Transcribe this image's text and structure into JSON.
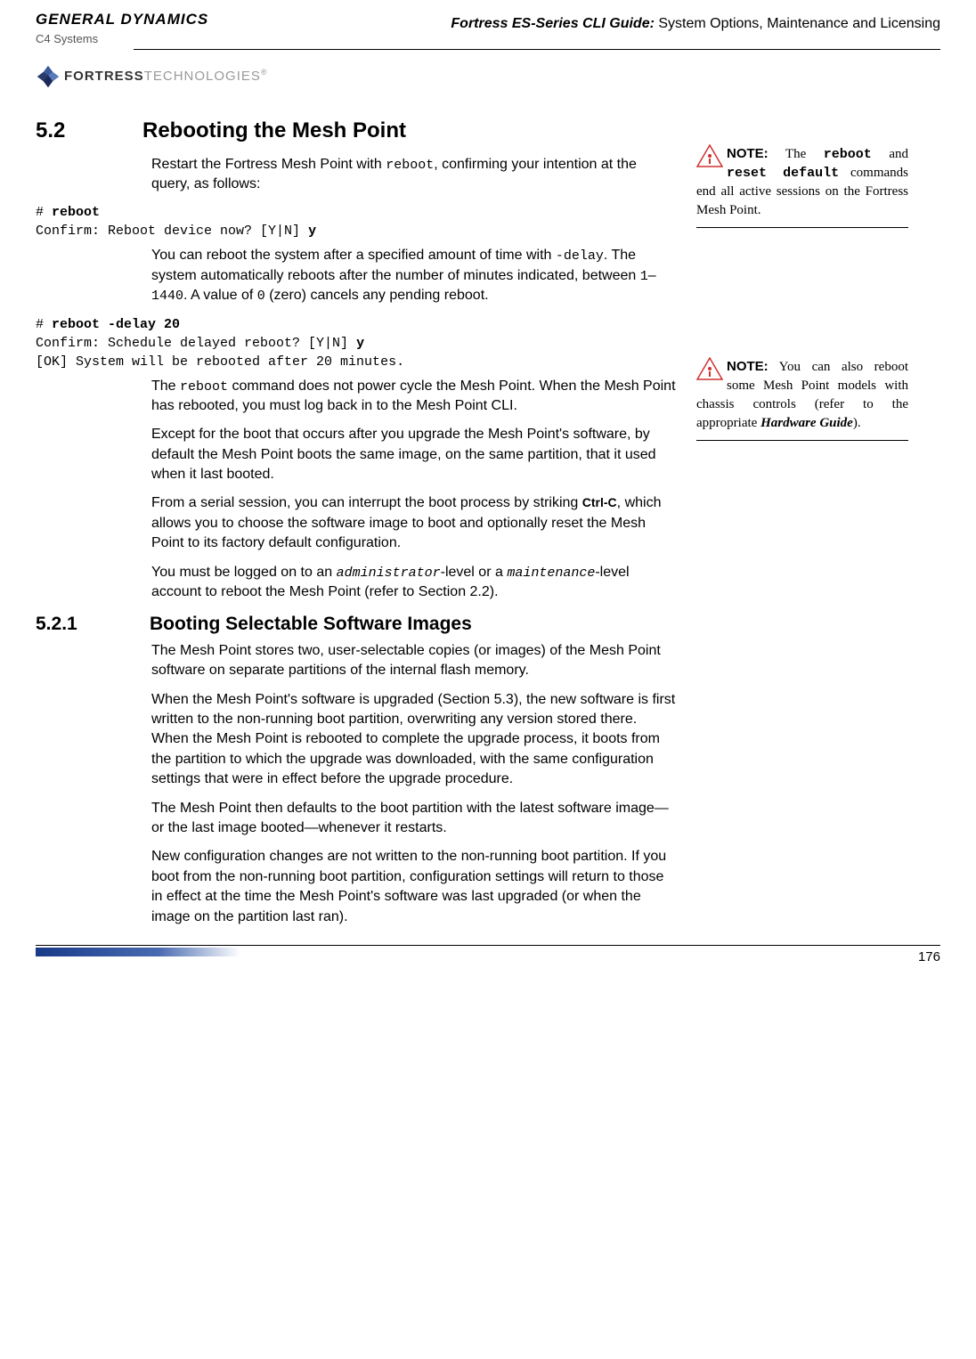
{
  "header": {
    "logo_line1": "GENERAL DYNAMICS",
    "logo_line2": "C4 Systems",
    "fortress": "FORTRESS",
    "tech": "TECHNOLOGIES",
    "reg": "®",
    "doc_title_bold": "Fortress ES-Series CLI Guide:",
    "doc_title_rest": " System Options, Maintenance and Licensing"
  },
  "section": {
    "num": "5.2",
    "title": "Rebooting the Mesh Point",
    "p1a": "Restart the Fortress Mesh Point with ",
    "p1_code": "reboot",
    "p1b": ", confirming your intention at the query, as follows:",
    "code1": "# reboot\nConfirm: Reboot device now? [Y|N] y",
    "code1_bold_1": "reboot",
    "code1_bold_2": "y",
    "p2a": "You can reboot the system after a specified amount of time with ",
    "p2_code1": "-delay",
    "p2b": ". The system automatically reboots after the number of minutes indicated, between ",
    "p2_code2": "1",
    "p2_dash": "–",
    "p2_code3": "1440",
    "p2c": ". A value of ",
    "p2_code4": " 0",
    "p2d": " (zero) cancels any pending reboot.",
    "code2_bold_1": "reboot -delay 20",
    "code2_bold_2": "y",
    "code2": "# reboot -delay 20\nConfirm: Schedule delayed reboot? [Y|N] y\n[OK] System will be rebooted after 20 minutes.",
    "p3a": "The ",
    "p3_code": "reboot",
    "p3b": " command does not power cycle the Mesh Point. When the Mesh Point has rebooted, you must log back in to the Mesh Point CLI.",
    "p4": "Except for the boot that occurs after you upgrade the Mesh Point's software, by default the Mesh Point boots the same image, on the same partition, that it used when it last booted.",
    "p5a": "From a serial session, you can interrupt the boot process by striking ",
    "p5_ctrl": "Ctrl-C",
    "p5b": ", which allows you to choose the software image to boot and optionally reset the Mesh Point to its factory default configuration.",
    "p6a": "You must be logged on to an ",
    "p6_code1": "administrator",
    "p6b": "-level or a ",
    "p6_code2": "maintenance",
    "p6c": "-level account to reboot the Mesh Point (refer to Section 2.2)."
  },
  "subsection": {
    "num": "5.2.1",
    "title": "Booting Selectable Software Images",
    "p1": "The Mesh Point stores two, user-selectable copies (or images) of the Mesh Point software on separate partitions of the internal flash memory.",
    "p2": "When the Mesh Point's software is upgraded (Section 5.3), the new software is first written to the non-running boot partition, overwriting any version stored there. When the Mesh Point is rebooted to complete the upgrade process, it boots from the partition to which the upgrade was downloaded, with the same configuration settings that were in effect before the upgrade procedure.",
    "p3": "The Mesh Point then defaults to the boot partition with the latest software image—or the last image booted—whenever it restarts.",
    "p4": "New configuration changes are not written to the non-running boot partition. If you boot from the non-running boot partition, configuration settings will return to those in effect at the time the Mesh Point's software was last upgraded (or when the image on the partition last ran)."
  },
  "notes": {
    "n1_label": "NOTE:",
    "n1a": " The ",
    "n1_code1": "reboot",
    "n1b": " and ",
    "n1_code2": "reset default",
    "n1c": " commands end all active sessions on the Fortress Mesh Point.",
    "n2_label": "NOTE:",
    "n2a": " You can also reboot some Mesh Point models with chassis controls (refer to the appropriate ",
    "n2_em": "Hardware Guide",
    "n2b": ")."
  },
  "page_number": "176"
}
